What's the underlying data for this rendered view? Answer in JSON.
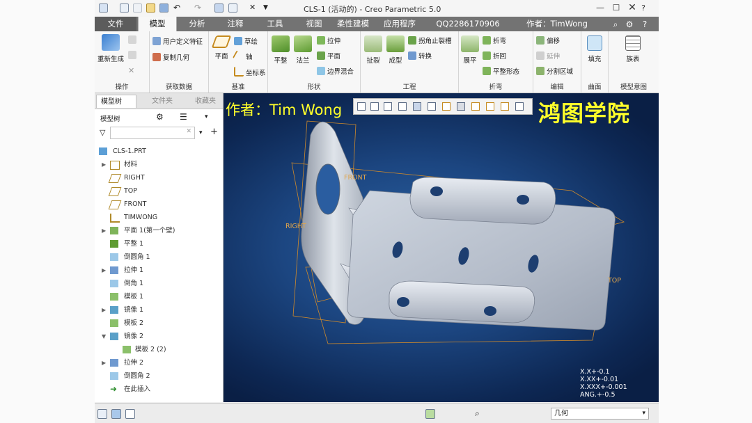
{
  "window": {
    "title": "CLS-1 (活动的) - Creo Parametric 5.0"
  },
  "tabs": [
    {
      "label": "文件"
    },
    {
      "label": "模型"
    },
    {
      "label": "分析"
    },
    {
      "label": "注释"
    },
    {
      "label": "工具"
    },
    {
      "label": "视图"
    },
    {
      "label": "柔性建模"
    },
    {
      "label": "应用程序"
    },
    {
      "label": "QQ2286170906"
    },
    {
      "label": "作者：TimWong"
    }
  ],
  "ribbon": {
    "groups": {
      "operations": "操作",
      "get_data": "获取数据",
      "datum": "基准",
      "shapes": "形状",
      "engineering": "工程",
      "bend": "折弯",
      "edit": "编辑",
      "surfaces": "曲面",
      "model_intent": "模型意图"
    },
    "regenerate": "重新生成",
    "user_feature": "用户定义特征",
    "copy_geometry": "复制几何",
    "plane": "平面",
    "sketch": "草绘",
    "axis": "轴",
    "csys": "坐标系",
    "flat": "平整",
    "flange": "法兰",
    "extrude": "拉伸",
    "planar": "平面",
    "boundary_blend": "边界混合",
    "rip": "扯裂",
    "form": "成型",
    "corner_relief": "拐角止裂槽",
    "convert": "转换",
    "unbend": "展平",
    "bend": "折弯",
    "bend_back": "折回",
    "flat_pattern": "平整形态",
    "mirror": "偏移",
    "extend": "延伸",
    "split_area": "分割区域",
    "fill": "填充",
    "table": "族表"
  },
  "panel": {
    "tabs": [
      "模型树",
      "文件夹",
      "收藏夹"
    ],
    "tree_label": "模型树",
    "search_placeholder": "",
    "items": [
      {
        "label": "CLS-1.PRT"
      },
      {
        "label": "材料"
      },
      {
        "label": "RIGHT"
      },
      {
        "label": "TOP"
      },
      {
        "label": "FRONT"
      },
      {
        "label": "TIMWONG"
      },
      {
        "label": "平面 1(第一个壁)"
      },
      {
        "label": "平整 1"
      },
      {
        "label": "倒圆角 1"
      },
      {
        "label": "拉伸 1"
      },
      {
        "label": "倒角 1"
      },
      {
        "label": "模板 1"
      },
      {
        "label": "镜像 1"
      },
      {
        "label": "模板 2"
      },
      {
        "label": "镜像 2"
      },
      {
        "label": "模板 2 (2)"
      },
      {
        "label": "拉伸 2"
      },
      {
        "label": "倒圆角 2"
      },
      {
        "label": "在此插入"
      }
    ]
  },
  "viewport": {
    "watermark_author": "作者：Tim Wong",
    "watermark_school": "鸿图学院",
    "datum_labels": [
      "FRONT",
      "RIGHT",
      "TOP"
    ],
    "tolerances": [
      "X.X+-0.1",
      "X.XX+-0.01",
      "X.XXX+-0.001",
      "ANG.+-0.5"
    ]
  },
  "status": {
    "filter_value": "几何"
  }
}
